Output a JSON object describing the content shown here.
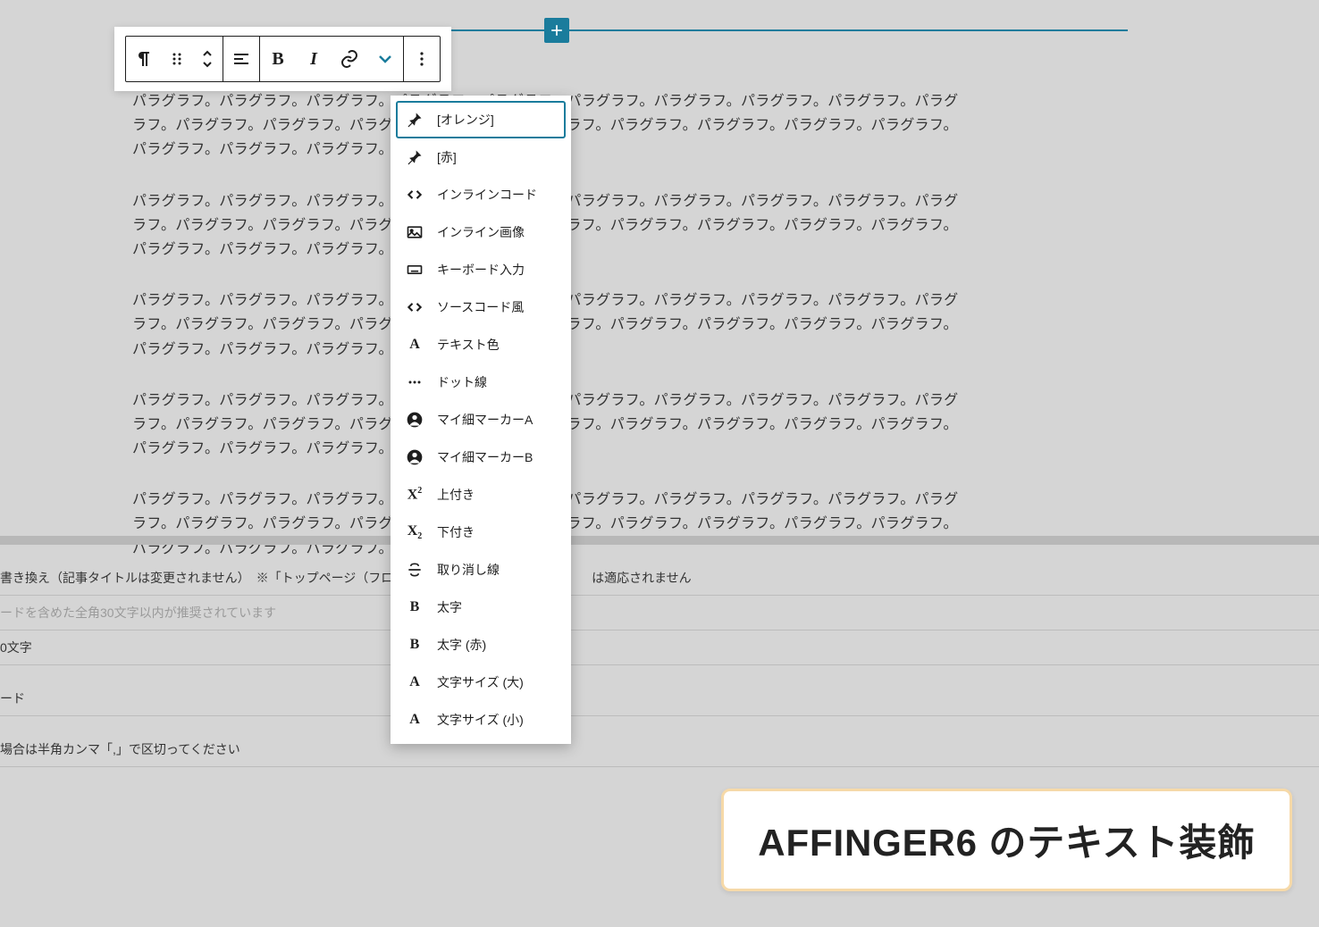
{
  "paragraph_unit": "パラグラフ。",
  "paragraph_repeat": 22,
  "paragraph_count": 5,
  "toolbar": {
    "buttons": [
      "paragraph",
      "drag",
      "move",
      "align",
      "bold",
      "italic",
      "link",
      "dropdown",
      "more"
    ]
  },
  "dropdown": {
    "items": [
      {
        "icon": "pin",
        "label": "[オレンジ]",
        "active": true
      },
      {
        "icon": "pin",
        "label": "[赤]"
      },
      {
        "icon": "code",
        "label": "インラインコード"
      },
      {
        "icon": "image",
        "label": "インライン画像"
      },
      {
        "icon": "keyboard",
        "label": "キーボード入力"
      },
      {
        "icon": "source",
        "label": "ソースコード風"
      },
      {
        "icon": "textA",
        "label": "テキスト色"
      },
      {
        "icon": "dots",
        "label": "ドット線"
      },
      {
        "icon": "person",
        "label": "マイ細マーカーA"
      },
      {
        "icon": "person",
        "label": "マイ細マーカーB"
      },
      {
        "icon": "sup",
        "label": "上付き"
      },
      {
        "icon": "sub",
        "label": "下付き"
      },
      {
        "icon": "strike",
        "label": "取り消し線"
      },
      {
        "icon": "boldB",
        "label": "太字"
      },
      {
        "icon": "boldB",
        "label": "太字 (赤)"
      },
      {
        "icon": "textA",
        "label": "文字サイズ (大)"
      },
      {
        "icon": "textA",
        "label": "文字サイズ (小)"
      }
    ]
  },
  "form": {
    "row1": "書き換え（記事タイトルは変更されません）　※「トップページ（フロン",
    "row1_suffix": "は適応されません",
    "row2_placeholder": "ードを含めた全角30文字以内が推奨されています",
    "row3": "0文字",
    "row4": "ード",
    "row5": "場合は半角カンマ「,」で区切ってください"
  },
  "badge": "AFFINGER6 のテキスト装飾"
}
